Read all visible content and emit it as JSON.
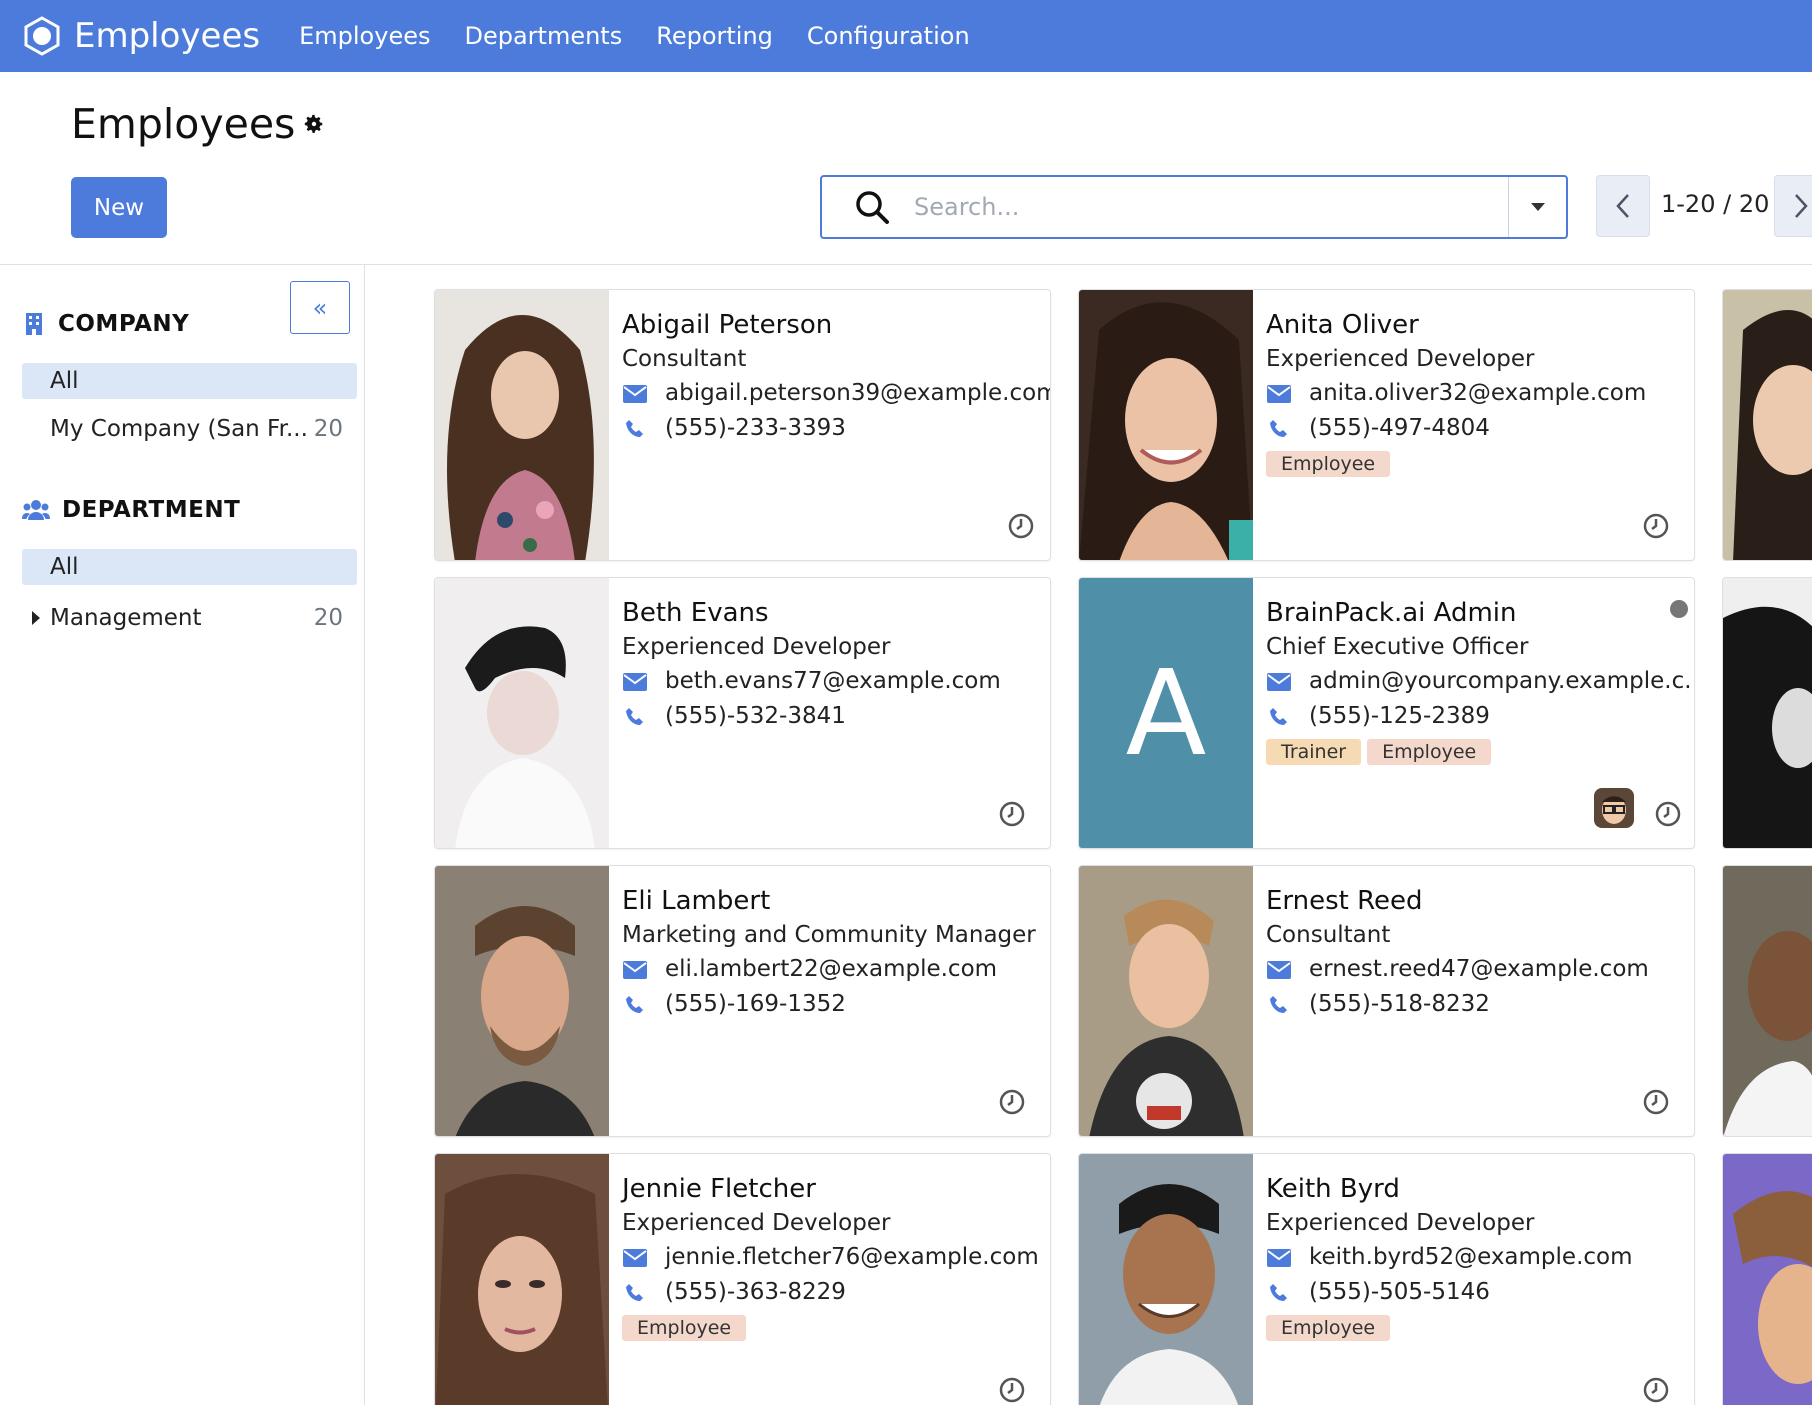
{
  "navbar": {
    "app_name": "Employees",
    "menu": [
      "Employees",
      "Departments",
      "Reporting",
      "Configuration"
    ],
    "accent": "#4c7bdb"
  },
  "control_panel": {
    "title": "Employees",
    "new_label": "New",
    "search_placeholder": "Search...",
    "pager": "1-20 / 20"
  },
  "sidebar": {
    "company_heading": "COMPANY",
    "company_items": [
      {
        "label": "All",
        "count": ""
      },
      {
        "label": "My Company (San Fr...",
        "count": "20"
      }
    ],
    "department_heading": "DEPARTMENT",
    "department_items": [
      {
        "label": "All",
        "count": ""
      },
      {
        "label": "Management",
        "count": "20"
      }
    ]
  },
  "employees": [
    {
      "name": "Abigail Peterson",
      "job": "Consultant",
      "email": "abigail.peterson39@example.com",
      "phone": "(555)-233-3393",
      "tags": []
    },
    {
      "name": "Anita Oliver",
      "job": "Experienced Developer",
      "email": "anita.oliver32@example.com",
      "phone": "(555)-497-4804",
      "tags": [
        "Employee"
      ]
    },
    {
      "name": "Beth Evans",
      "job": "Experienced Developer",
      "email": "beth.evans77@example.com",
      "phone": "(555)-532-3841",
      "tags": []
    },
    {
      "name": "BrainPack.ai Admin",
      "job": "Chief Executive Officer",
      "email": "admin@yourcompany.example.c...",
      "phone": "(555)-125-2389",
      "tags": [
        "Trainer",
        "Employee"
      ],
      "initial": "A"
    },
    {
      "name": "Eli Lambert",
      "job": "Marketing and Community Manager",
      "email": "eli.lambert22@example.com",
      "phone": "(555)-169-1352",
      "tags": []
    },
    {
      "name": "Ernest Reed",
      "job": "Consultant",
      "email": "ernest.reed47@example.com",
      "phone": "(555)-518-8232",
      "tags": []
    },
    {
      "name": "Jennie Fletcher",
      "job": "Experienced Developer",
      "email": "jennie.fletcher76@example.com",
      "phone": "(555)-363-8229",
      "tags": [
        "Employee"
      ]
    },
    {
      "name": "Keith Byrd",
      "job": "Experienced Developer",
      "email": "keith.byrd52@example.com",
      "phone": "(555)-505-5146",
      "tags": [
        "Employee"
      ]
    }
  ],
  "icons": {
    "logo": "app-logo-icon",
    "gear": "gear-icon",
    "search": "search-icon",
    "email": "envelope-icon",
    "phone": "phone-icon",
    "activity": "clock-icon"
  }
}
